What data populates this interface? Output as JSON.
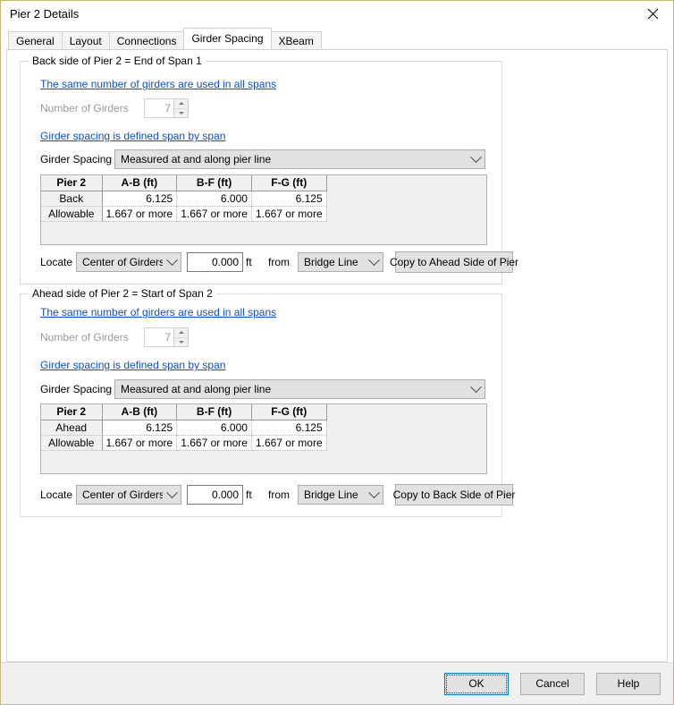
{
  "window": {
    "title": "Pier 2 Details",
    "close_icon": "close-icon"
  },
  "tabs": [
    {
      "label": "General",
      "selected": false
    },
    {
      "label": "Layout",
      "selected": false
    },
    {
      "label": "Connections",
      "selected": false
    },
    {
      "label": "Girder Spacing",
      "selected": true
    },
    {
      "label": "XBeam",
      "selected": false
    }
  ],
  "sections": [
    {
      "title": "Back side of Pier 2 = End of Span 1",
      "link_same_girders": "The same number of girders are used in all spans",
      "number_of_girders_label": "Number of Girders",
      "number_of_girders_value": "7",
      "link_spacing_defined": "Girder spacing is defined span by span",
      "girder_spacing_label": "Girder Spacing",
      "girder_spacing_value": "Measured at and along pier line",
      "grid": {
        "headers": [
          "Pier 2",
          "A-B (ft)",
          "B-F (ft)",
          "F-G (ft)"
        ],
        "rows": [
          {
            "label": "Back",
            "values": [
              "6.125",
              "6.000",
              "6.125"
            ]
          },
          {
            "label": "Allowable",
            "values": [
              "1.667 or more",
              "1.667 or more",
              "1.667 or more"
            ]
          }
        ]
      },
      "locate_label": "Locate",
      "locate_value": "Center of Girders",
      "offset_value": "0.000",
      "units_label": "ft",
      "from_label": "from",
      "from_value": "Bridge Line",
      "copy_button": "Copy to Ahead Side of Pier"
    },
    {
      "title": "Ahead side of Pier 2 = Start of Span 2",
      "link_same_girders": "The same number of girders are used in all spans",
      "number_of_girders_label": "Number of Girders",
      "number_of_girders_value": "7",
      "link_spacing_defined": "Girder spacing is defined span by span",
      "girder_spacing_label": "Girder Spacing",
      "girder_spacing_value": "Measured at and along pier line",
      "grid": {
        "headers": [
          "Pier 2",
          "A-B (ft)",
          "B-F (ft)",
          "F-G (ft)"
        ],
        "rows": [
          {
            "label": "Ahead",
            "values": [
              "6.125",
              "6.000",
              "6.125"
            ]
          },
          {
            "label": "Allowable",
            "values": [
              "1.667 or more",
              "1.667 or more",
              "1.667 or more"
            ]
          }
        ]
      },
      "locate_label": "Locate",
      "locate_value": "Center of Girders",
      "offset_value": "0.000",
      "units_label": "ft",
      "from_label": "from",
      "from_value": "Bridge Line",
      "copy_button": "Copy to Back Side of Pier"
    }
  ],
  "footer": {
    "ok_label": "OK",
    "cancel_label": "Cancel",
    "help_label": "Help"
  },
  "colors": {
    "window_border": "#c8b87e",
    "link": "#0b52c8",
    "default_button_border": "#0078d7",
    "control_face": "#e1e1e1",
    "footer_background": "#f0f0f0"
  }
}
